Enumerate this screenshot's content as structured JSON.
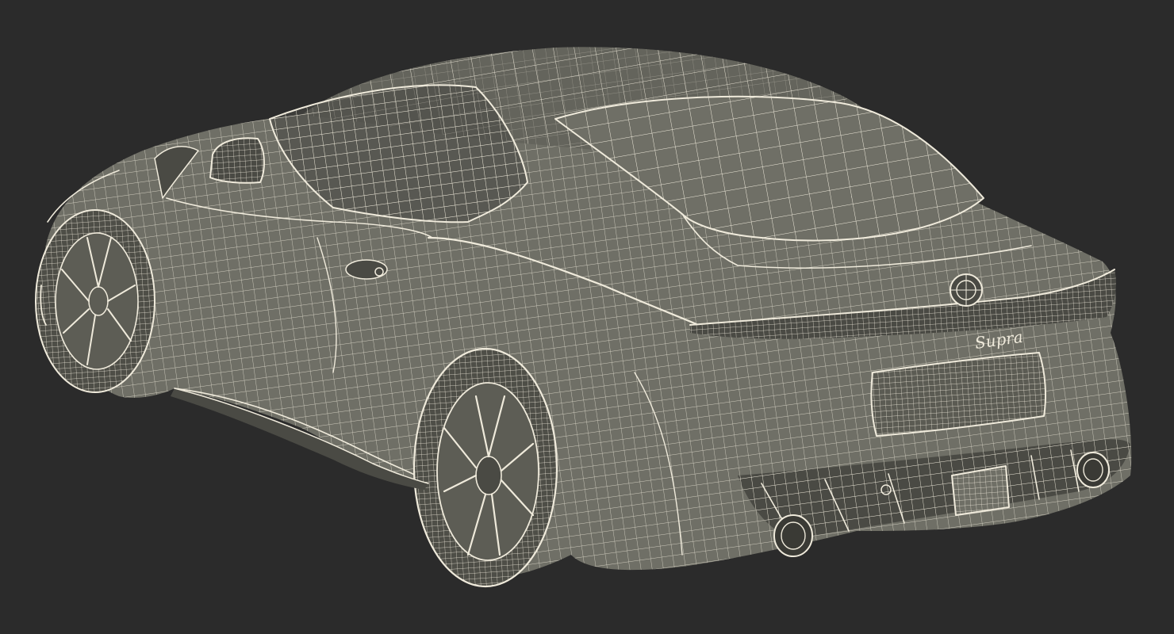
{
  "scene": {
    "subject": "car-wireframe-render",
    "badge_text": "Supra",
    "colors": {
      "background": "#2b2b2b",
      "surface": "#6f6f66",
      "wire": "#efeadb"
    }
  }
}
